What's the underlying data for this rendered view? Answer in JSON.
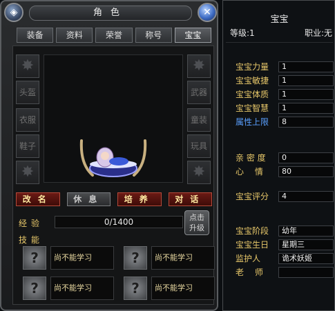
{
  "window_title": "角色",
  "tabs": [
    "装备",
    "资料",
    "荣誉",
    "称号",
    "宝宝"
  ],
  "active_tab": 4,
  "slots_left": [
    "",
    "头盔",
    "衣服",
    "鞋子",
    ""
  ],
  "slots_right": [
    "",
    "武器",
    "童装",
    "玩具",
    ""
  ],
  "buttons": {
    "rename": "改名",
    "rest": "休息",
    "nurture": "培养",
    "talk": "对话"
  },
  "exp": {
    "label": "经验",
    "value": "0/1400"
  },
  "upgrade": {
    "line1": "点击",
    "line2": "升级"
  },
  "skills_label": "技能",
  "skills": [
    "尚不能学习",
    "尚不能学习",
    "尚不能学习",
    "尚不能学习"
  ],
  "pet": {
    "name": "宝宝",
    "level": "等级:1",
    "class": "职业:无"
  },
  "stats": [
    {
      "label": "宝宝力量",
      "value": "1"
    },
    {
      "label": "宝宝敏捷",
      "value": "1"
    },
    {
      "label": "宝宝体质",
      "value": "1"
    },
    {
      "label": "宝宝智慧",
      "value": "1"
    },
    {
      "label": "属性上限",
      "value": "8"
    }
  ],
  "mood": [
    {
      "label": "亲 密 度",
      "value": "0"
    },
    {
      "label": "心　 情",
      "value": "80"
    }
  ],
  "score": {
    "label": "宝宝评分",
    "value": "4"
  },
  "details": [
    {
      "label": "宝宝阶段",
      "value": "幼年"
    },
    {
      "label": "宝宝生日",
      "value": "星期三"
    },
    {
      "label": "监护人",
      "value": "诡术妖姬"
    },
    {
      "label": "老　 师",
      "value": ""
    }
  ],
  "colors": {
    "accent_gold": "#e8c86a",
    "attr_blue": "#5aa0ff",
    "button_red": "#6a1a14"
  }
}
